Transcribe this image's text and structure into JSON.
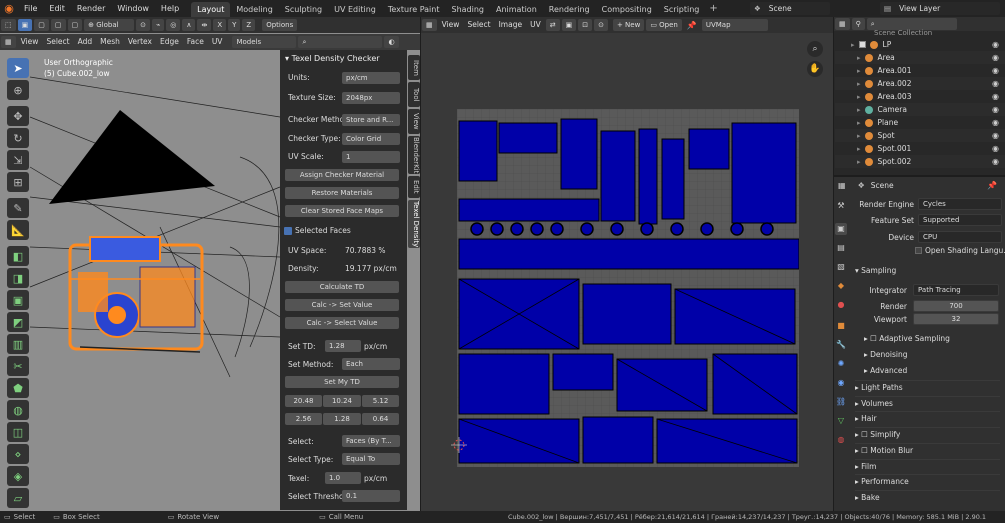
{
  "topmenu": [
    "File",
    "Edit",
    "Render",
    "Window",
    "Help"
  ],
  "workspaces": [
    "Layout",
    "Modeling",
    "Sculpting",
    "UV Editing",
    "Texture Paint",
    "Shading",
    "Animation",
    "Rendering",
    "Compositing",
    "Scripting"
  ],
  "scene_name": "Scene",
  "view_layer": "View Layer",
  "header_tools": {
    "transform": "Global",
    "options": "Options",
    "axes": [
      "X",
      "Y",
      "Z"
    ]
  },
  "viewport": {
    "menus": [
      "View",
      "Select",
      "Add",
      "Mesh",
      "Vertex",
      "Edge",
      "Face",
      "UV"
    ],
    "mode": "Models",
    "overlay_line1": "User Orthographic",
    "overlay_line2": "(5) Cube.002_low"
  },
  "npanel": {
    "title": "Texel Density Checker",
    "units_label": "Units:",
    "units_val": "px/cm",
    "tex_label": "Texture Size:",
    "tex_val": "2048px",
    "checker_method_label": "Checker Metho",
    "checker_method_val": "Store and R...",
    "checker_type_label": "Checker Type:",
    "checker_type_val": "Color Grid",
    "uvscale_label": "UV Scale:",
    "uvscale_val": "1",
    "btn_assign": "Assign Checker Material",
    "btn_restore": "Restore Materials",
    "btn_clear": "Clear Stored Face Maps",
    "selected_faces": "Selected Faces",
    "uvspace_label": "UV Space:",
    "uvspace_val": "70.7883 %",
    "density_label": "Density:",
    "density_val": "19.177 px/cm",
    "btn_calc": "Calculate TD",
    "btn_calc_set": "Calc -> Set Value",
    "btn_calc_select": "Calc -> Select Value",
    "settd_label": "Set TD:",
    "settd_val": "1.28",
    "settd_unit": "px/cm",
    "setmethod_label": "Set Method:",
    "setmethod_val": "Each",
    "btn_setmy": "Set My TD",
    "presets_row1": [
      "20.48",
      "10.24",
      "5.12"
    ],
    "presets_row2": [
      "2.56",
      "1.28",
      "0.64"
    ],
    "select_label": "Select:",
    "select_val": "Faces (By T...",
    "selecttype_label": "Select Type:",
    "selecttype_val": "Equal To",
    "texel_label": "Texel:",
    "texel_val": "1.0",
    "texel_unit": "px/cm",
    "threshold_label": "Select Thresho...",
    "threshold_val": "0.1"
  },
  "side_tabs": [
    "Item",
    "Tool",
    "View",
    "BlenderKit",
    "Edit",
    "Texel Density"
  ],
  "uv_header": {
    "menus": [
      "View",
      "Select",
      "Image",
      "UV"
    ],
    "new": "New",
    "open": "Open",
    "uvmap": "UVMap"
  },
  "outliner": {
    "collection": "Scene Collection",
    "items": [
      "LP",
      "Area",
      "Area.001",
      "Area.002",
      "Area.003",
      "Camera",
      "Plane",
      "Spot",
      "Spot.001",
      "Spot.002"
    ]
  },
  "properties": {
    "scene": "Scene",
    "render_engine_label": "Render Engine",
    "render_engine": "Cycles",
    "feature_set_label": "Feature Set",
    "feature_set": "Supported",
    "device_label": "Device",
    "device": "CPU",
    "osl": "Open Shading Langu...",
    "sampling": "Sampling",
    "integrator_label": "Integrator",
    "integrator": "Path Tracing",
    "render_label": "Render",
    "render_val": "700",
    "viewport_label": "Viewport",
    "viewport_val": "32",
    "adaptive": "Adaptive Sampling",
    "denoising": "Denoising",
    "advanced": "Advanced",
    "sections": [
      "Light Paths",
      "Volumes",
      "Hair",
      "Simplify",
      "Motion Blur",
      "Film",
      "Performance",
      "Bake"
    ]
  },
  "status": {
    "select": "Select",
    "box": "Box Select",
    "rotate": "Rotate View",
    "call": "Call Menu",
    "stats": "Cube.002_low | Вершин:7,451/7,451 | Рёбер:21,614/21,614 | Граней:14,237/14,237 | Треуг.:14,237 | Objects:40/76 | Memory: 585.1 MiB | 2.90.1"
  },
  "colors": {
    "accent": "#4772b3",
    "uvblue": "#0000a8",
    "orange": "#ff8a1e"
  }
}
